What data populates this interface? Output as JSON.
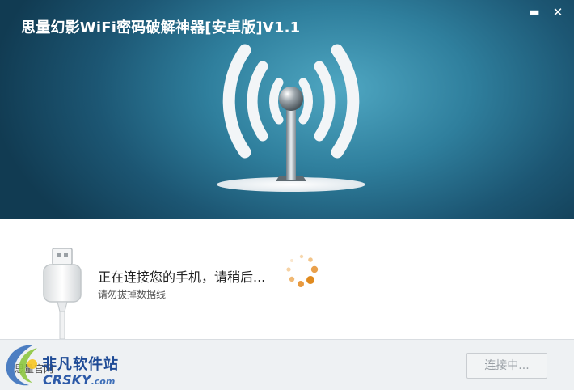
{
  "window": {
    "title": "思量幻影WiFi密码破解神器[安卓版]V1.1",
    "minimize_glyph": "▬",
    "close_glyph": "✕"
  },
  "status": {
    "message": "正在连接您的手机，请稍后...",
    "hint": "请勿拔掉数据线"
  },
  "footer": {
    "link_text": "思量官网",
    "connect_button": "连接中..."
  },
  "watermark": {
    "name_cn": "非凡软件站",
    "name_en": "CRSKY",
    "domain_suffix": ".com"
  },
  "icons": {
    "hero": "wifi-antenna-icon",
    "usb": "usb-cable-icon",
    "spinner": "loading-spinner-icon"
  },
  "colors": {
    "banner_dark": "#113b52",
    "banner_light": "#4fa7c2",
    "spinner_orange": "#e08a1e",
    "footer_bg": "#eef1f3"
  }
}
